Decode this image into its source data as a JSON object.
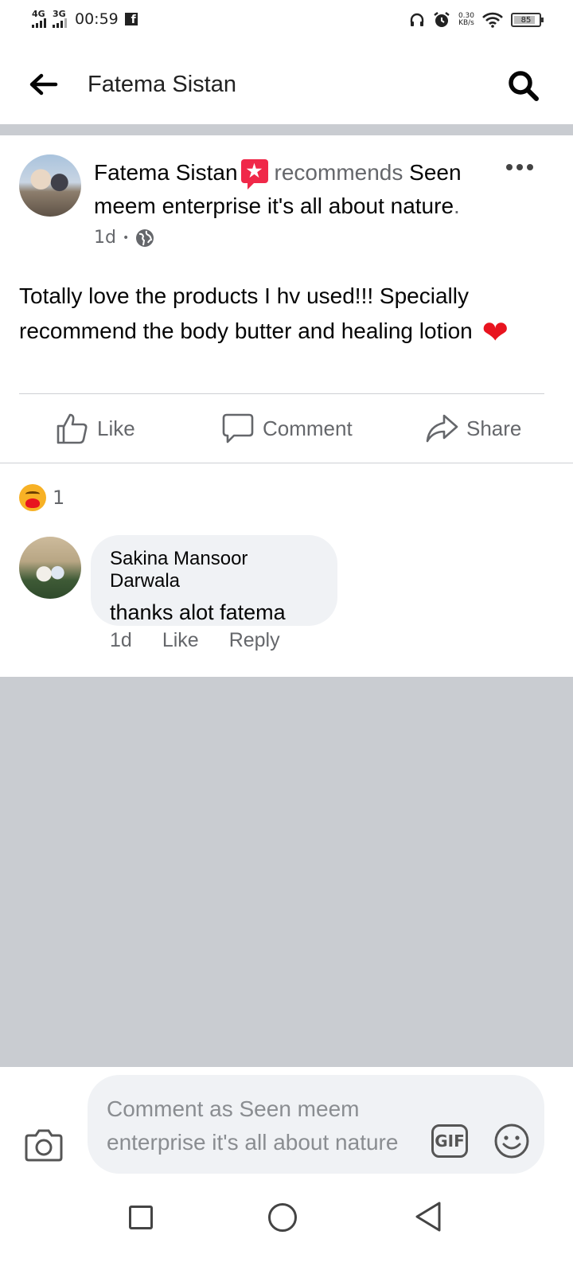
{
  "status_bar": {
    "network_1": "4G",
    "network_2": "3G",
    "time": "00:59",
    "speed_value": "0.30",
    "speed_unit": "KB/s",
    "battery": "85",
    "battery_level_percent": 85
  },
  "appbar": {
    "title": "Fatema Sistan"
  },
  "post": {
    "author": "Fatema Sistan",
    "recommends": "recommends",
    "page": "Seen meem enterprise it's all about nature",
    "period": ".",
    "time": "1d",
    "dot": "•",
    "text": "Totally love the products I hv used!!! Specially recommend the body butter and healing lotion",
    "heart": "❤",
    "reaction_count": "1"
  },
  "actions": {
    "like": "Like",
    "comment": "Comment",
    "share": "Share"
  },
  "comment": {
    "author": "Sakina Mansoor Darwala",
    "text": "thanks alot fatema",
    "time": "1d",
    "like": "Like",
    "reply": "Reply"
  },
  "composer": {
    "placeholder": "Comment as Seen meem enterprise it's all about nature",
    "gif": "GIF"
  },
  "icons": [
    "back-arrow-icon",
    "search-icon",
    "more-icon",
    "globe-icon",
    "like-icon",
    "comment-icon",
    "share-icon",
    "care-reaction-icon",
    "camera-icon",
    "emoji-icon"
  ],
  "colors": {
    "divider": "#c9ccd1",
    "secondary_text": "#65676b",
    "bubble": "#f0f2f5",
    "badge": "#f02849"
  }
}
